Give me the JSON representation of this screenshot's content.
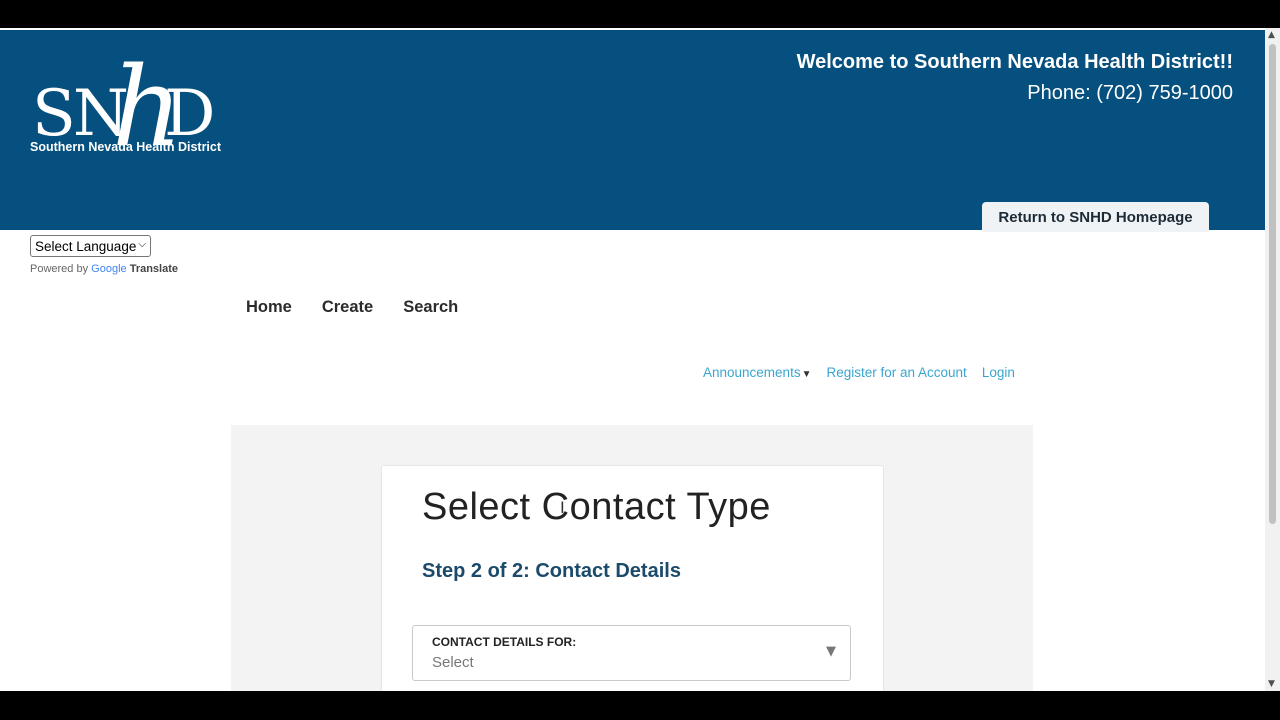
{
  "header": {
    "logo_letters": "SN",
    "logo_h": "h",
    "logo_d": "D",
    "logo_tagline": "Southern Nevada Health District",
    "welcome": "Welcome to Southern Nevada Health District!!",
    "phone": "Phone: (702) 759-1000",
    "return_button": "Return to SNHD Homepage",
    "background_color": "#06507f"
  },
  "language": {
    "select_value": "Select Language",
    "powered_by": "Powered by",
    "google": "Google",
    "translate": "Translate"
  },
  "nav": {
    "items": [
      "Home",
      "Create",
      "Search"
    ]
  },
  "toplinks": {
    "announcements": "Announcements",
    "register": "Register for an Account",
    "login": "Login",
    "link_color": "#3aa6cf"
  },
  "card": {
    "title": "Select Contact Type",
    "step": "Step 2 of 2: Contact Details",
    "dropdown_label": "CONTACT DETAILS FOR:",
    "dropdown_value": "Select"
  },
  "icons": {
    "caret": "caret-down-icon",
    "dropdown_arrow": "triangle-down-icon",
    "scroll_up": "scroll-up-arrow-icon",
    "scroll_down": "scroll-down-arrow-icon"
  }
}
